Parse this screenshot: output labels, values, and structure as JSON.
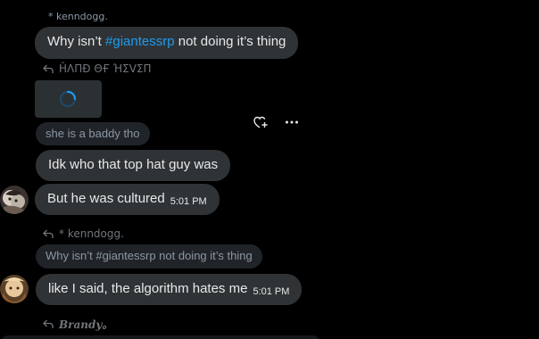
{
  "messages": {
    "m1": {
      "sender": "* kenndogg.",
      "text_before": "Why isn’t ",
      "hashtag": "#giantessrp",
      "text_after": " not doing it’s thing"
    },
    "m2": {
      "reply_to": "ĤΛΠÐ ΘҒ ΉΣVΣП"
    },
    "m3": {
      "quote": "she is a baddy tho"
    },
    "m4": {
      "text": "Idk who that top hat guy was"
    },
    "m5": {
      "text": "But he was cultured",
      "time": "5:01 PM"
    },
    "m6": {
      "reply_to": "* kenndogg.",
      "quote": "Why isn’t #giantessrp not doing it’s thing"
    },
    "m7": {
      "text": "like I said, the algorithm hates me",
      "time": "5:01 PM"
    },
    "m8": {
      "reply_to": "𝑩𝒓𝒂𝒏𝒅𝒚。"
    }
  },
  "icons": {
    "reply": "reply-arrow-icon",
    "react": "heart-plus-icon",
    "more": "more-dots-icon",
    "loading": "spinner-icon"
  },
  "colors": {
    "background": "#000000",
    "bubble": "#2f3336",
    "quote_bubble": "#202327",
    "hashtag": "#1d9bf0",
    "muted": "#71767b"
  }
}
